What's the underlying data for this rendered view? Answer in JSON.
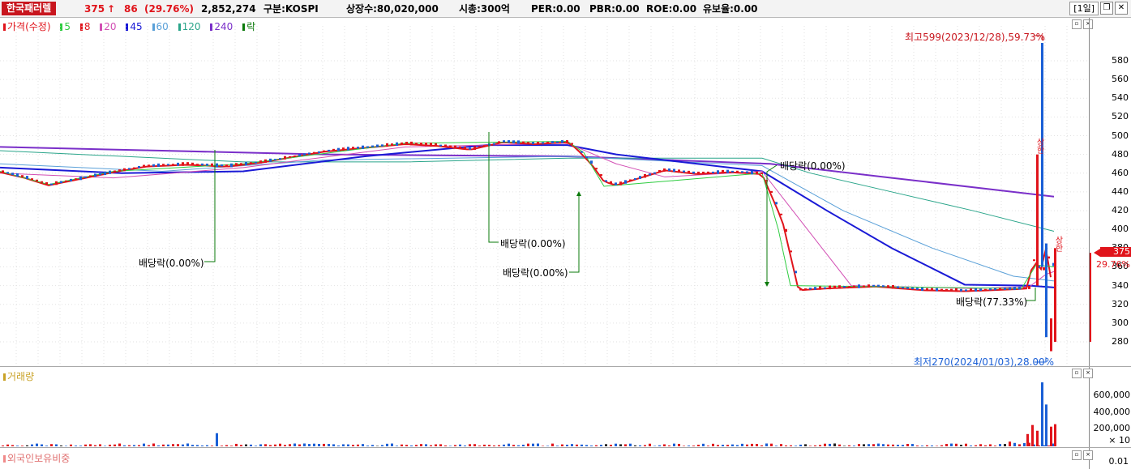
{
  "topbar": {
    "stock_name": "한국패러렐",
    "price": "375",
    "arrow": "↑",
    "change": "86",
    "change_pct": "(29.76%)",
    "volume": "2,852,274",
    "market": "구분:KOSPI",
    "shares": "상장수:80,020,000",
    "mcap": "시총:300억",
    "per": "PER:0.00",
    "pbr": "PBR:0.00",
    "roe": "ROE:0.00",
    "float": "유보율:0.00",
    "period_label": "[1일]"
  },
  "price_panel": {
    "legend": [
      {
        "label": "가격(수정)",
        "color": "#e0141b"
      },
      {
        "label": "5",
        "color": "#2ecc40"
      },
      {
        "label": "8",
        "color": "#e0141b"
      },
      {
        "label": "20",
        "color": "#d24fb4"
      },
      {
        "label": "45",
        "color": "#1a1ad6"
      },
      {
        "label": "60",
        "color": "#5aa0d8"
      },
      {
        "label": "120",
        "color": "#2aa58a"
      },
      {
        "label": "240",
        "color": "#7a2fc9"
      },
      {
        "label": "락",
        "color": "#0a7a0a"
      }
    ],
    "annotations": {
      "high": "최고599(2023/12/28),59.73%",
      "low": "최저270(2024/01/03),28.00%",
      "div1": "배당락(0.00%)",
      "div2": "배당락(0.00%)",
      "div3": "배당락(0.00%)",
      "div4": "배당락(0.00%)",
      "div5": "배당락(77.33%)",
      "up1": "상한",
      "up2": "상한"
    },
    "y_ticks": [
      "580",
      "560",
      "540",
      "520",
      "500",
      "480",
      "460",
      "440",
      "420",
      "400",
      "380",
      "360",
      "340",
      "320",
      "300",
      "280"
    ],
    "current_price": "375",
    "current_pct": "29.76%"
  },
  "volume_panel": {
    "legend": "거래량",
    "y_ticks": [
      "600,000",
      "400,000",
      "200,000"
    ],
    "unit": "× 10"
  },
  "foreign_panel": {
    "legend": "외국인보유비중",
    "y_tick": "0.01"
  },
  "colors": {
    "up": "#e0141b",
    "down": "#1a5fd6",
    "accent": "#c8161e"
  }
}
